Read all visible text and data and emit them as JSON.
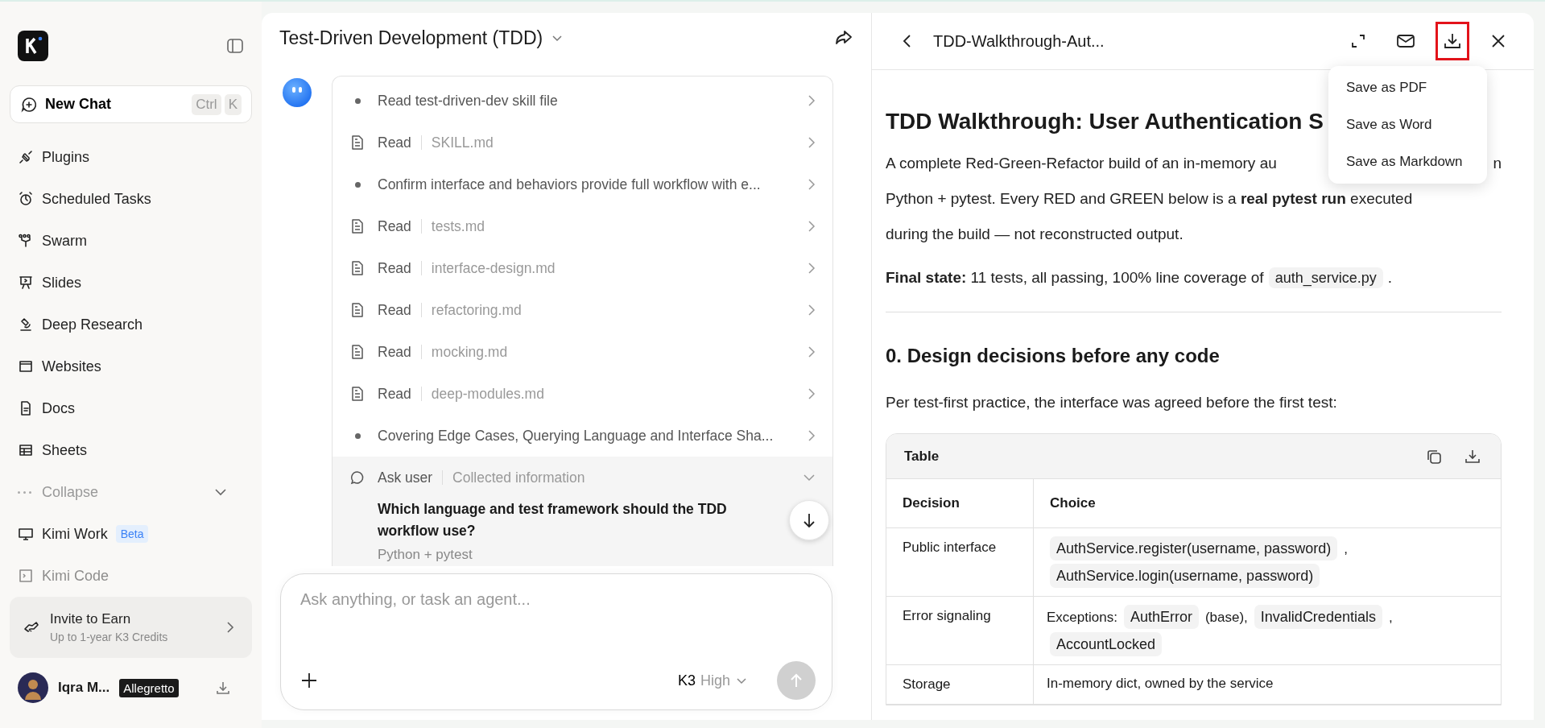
{
  "sidebar": {
    "new_chat": {
      "label": "New Chat",
      "keys": [
        "Ctrl",
        "K"
      ]
    },
    "items": [
      {
        "label": "Plugins"
      },
      {
        "label": "Scheduled Tasks"
      },
      {
        "label": "Swarm"
      },
      {
        "label": "Slides"
      },
      {
        "label": "Deep Research"
      },
      {
        "label": "Websites"
      },
      {
        "label": "Docs"
      },
      {
        "label": "Sheets"
      }
    ],
    "collapse": {
      "label": "Collapse",
      "expanded": false
    },
    "extra_items": [
      {
        "label": "Kimi Work",
        "badge": "Beta"
      },
      {
        "label": "Kimi Code"
      }
    ],
    "invite": {
      "title": "Invite to Earn",
      "subtitle": "Up to 1-year K3 Credits"
    },
    "user": {
      "name": "Iqra M...",
      "plan": "Allegretto"
    }
  },
  "chat": {
    "title": "Test-Driven Development (TDD)",
    "steps": [
      {
        "kind": "step",
        "text": "Read test-driven-dev skill file"
      },
      {
        "kind": "read",
        "label": "Read",
        "file": "SKILL.md"
      },
      {
        "kind": "step",
        "text": "Confirm interface and behaviors provide full workflow with e..."
      },
      {
        "kind": "read",
        "label": "Read",
        "file": "tests.md"
      },
      {
        "kind": "read",
        "label": "Read",
        "file": "interface-design.md"
      },
      {
        "kind": "read",
        "label": "Read",
        "file": "refactoring.md"
      },
      {
        "kind": "read",
        "label": "Read",
        "file": "mocking.md"
      },
      {
        "kind": "read",
        "label": "Read",
        "file": "deep-modules.md"
      },
      {
        "kind": "step",
        "text": "Covering Edge Cases, Querying Language and Interface Sha..."
      },
      {
        "kind": "ask",
        "label": "Ask user",
        "detail": "Collected information",
        "expanded": true,
        "question": "Which language and test framework should the TDD workflow use?",
        "answer": "Python + pytest"
      }
    ],
    "input": {
      "placeholder": "Ask anything, or task an agent...",
      "model": "K3",
      "effort": "High"
    }
  },
  "document": {
    "title": "TDD-Walkthrough-Aut...",
    "download_highlighted": true,
    "menu": [
      "Save as PDF",
      "Save as Word",
      "Save as Markdown"
    ],
    "heading": "TDD Walkthrough: User Authentication S",
    "intro_lines": [
      {
        "left": "A complete Red-Green-Refactor build of an in-memory au",
        "right": "n"
      },
      {
        "left": "Python + pytest. Every RED and GREEN below is a **real pytest run** executed"
      },
      {
        "left": "during the build — not reconstructed output."
      }
    ],
    "final_state": [
      {
        "code": false,
        "text": "**Final state:** 11 tests, all passing, 100% line coverage of"
      },
      {
        "code": true,
        "text": "auth_service.py"
      },
      {
        "code": false,
        "text": "."
      }
    ],
    "section": "0. Design decisions before any code",
    "section_intro": "Per test-first practice, the interface was agreed before the first test:",
    "table": {
      "title": "Table",
      "columns": [
        "Decision",
        "Choice"
      ],
      "rows": [
        {
          "decision": "Public interface",
          "choice": [
            {
              "code": true,
              "text": "AuthService.register(username, password)"
            },
            {
              "code": false,
              "text": ","
            },
            {
              "code": true,
              "text": "AuthService.login(username, password)"
            }
          ]
        },
        {
          "decision": "Error signaling",
          "choice": [
            {
              "code": false,
              "text": "Exceptions:"
            },
            {
              "code": true,
              "text": "AuthError"
            },
            {
              "code": false,
              "text": "(base),"
            },
            {
              "code": true,
              "text": "InvalidCredentials"
            },
            {
              "code": false,
              "text": ","
            },
            {
              "code": true,
              "text": "AccountLocked"
            }
          ]
        },
        {
          "decision": "Storage",
          "choice": [
            {
              "code": false,
              "text": "In-memory dict, owned by the service"
            }
          ]
        }
      ]
    }
  }
}
